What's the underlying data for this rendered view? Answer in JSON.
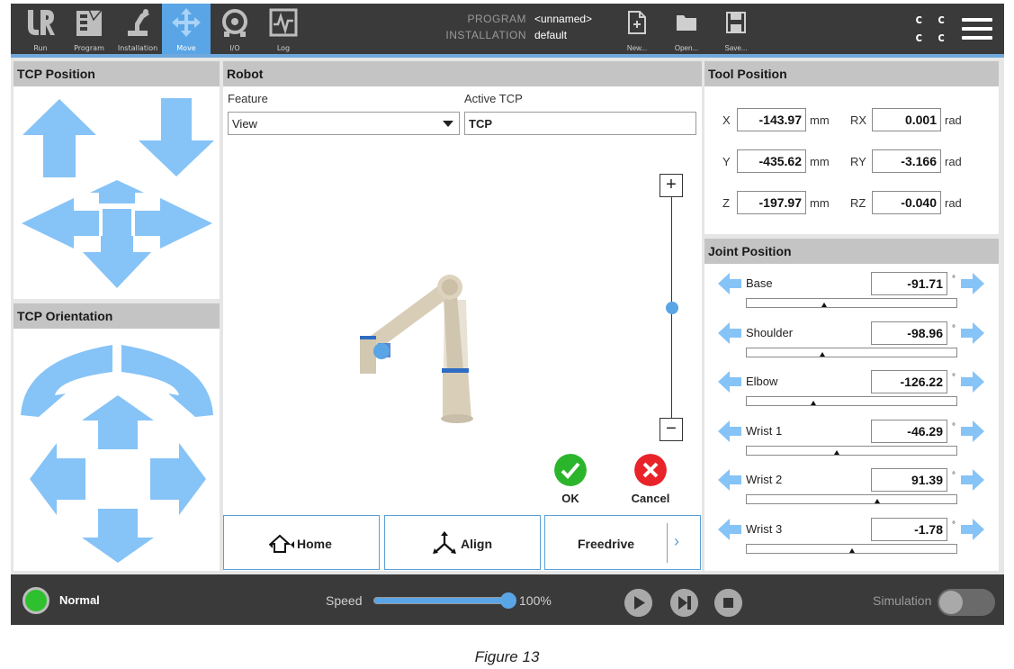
{
  "nav": {
    "tabs": [
      {
        "label": "Run",
        "icon": "ur-logo-icon"
      },
      {
        "label": "Program",
        "icon": "program-icon"
      },
      {
        "label": "Installation",
        "icon": "installation-icon"
      },
      {
        "label": "Move",
        "icon": "move-icon",
        "active": true
      },
      {
        "label": "I/O",
        "icon": "io-icon"
      },
      {
        "label": "Log",
        "icon": "log-icon"
      }
    ],
    "program_label": "PROGRAM",
    "program_value": "<unnamed>",
    "installation_label": "INSTALLATION",
    "installation_value": "default",
    "new_label": "New...",
    "open_label": "Open...",
    "save_label": "Save...",
    "cc_top": "c c",
    "cc_bottom": "c c"
  },
  "tcp_position": {
    "title": "TCP Position"
  },
  "tcp_orientation": {
    "title": "TCP Orientation"
  },
  "robot": {
    "title": "Robot",
    "feature_label": "Feature",
    "feature_value": "View",
    "active_tcp_label": "Active TCP",
    "active_tcp_value": "TCP",
    "zoom_in": "+",
    "zoom_out": "−",
    "zoom_level": 0.5,
    "ok_label": "OK",
    "cancel_label": "Cancel",
    "home_label": "Home",
    "align_label": "Align",
    "freedrive_label": "Freedrive",
    "freedrive_chevron": "›"
  },
  "tool_position": {
    "title": "Tool Position",
    "rows": [
      {
        "axis": "X",
        "value": "-143.97",
        "unit": "mm",
        "raxis": "RX",
        "rvalue": "0.001",
        "runit": "rad"
      },
      {
        "axis": "Y",
        "value": "-435.62",
        "unit": "mm",
        "raxis": "RY",
        "rvalue": "-3.166",
        "runit": "rad"
      },
      {
        "axis": "Z",
        "value": "-197.97",
        "unit": "mm",
        "raxis": "RZ",
        "rvalue": "-0.040",
        "runit": "rad"
      }
    ]
  },
  "joint_position": {
    "title": "Joint Position",
    "degree_symbol": "°",
    "joints": [
      {
        "name": "Base",
        "value": "-91.71",
        "slider_fraction": 0.37
      },
      {
        "name": "Shoulder",
        "value": "-98.96",
        "slider_fraction": 0.36
      },
      {
        "name": "Elbow",
        "value": "-126.22",
        "slider_fraction": 0.32
      },
      {
        "name": "Wrist 1",
        "value": "-46.29",
        "slider_fraction": 0.43
      },
      {
        "name": "Wrist 2",
        "value": "91.39",
        "slider_fraction": 0.62
      },
      {
        "name": "Wrist 3",
        "value": "-1.78",
        "slider_fraction": 0.5
      }
    ]
  },
  "bottom": {
    "status": "Normal",
    "status_color": "#2fc02f",
    "speed_label": "Speed",
    "speed_value": "100%",
    "speed_fraction": 1.0,
    "simulation_label": "Simulation"
  },
  "caption": "Figure 13",
  "colors": {
    "accent": "#5aa5e6",
    "arrow": "#86c3f7",
    "ok": "#2bb52b",
    "cancel": "#e8242a"
  }
}
